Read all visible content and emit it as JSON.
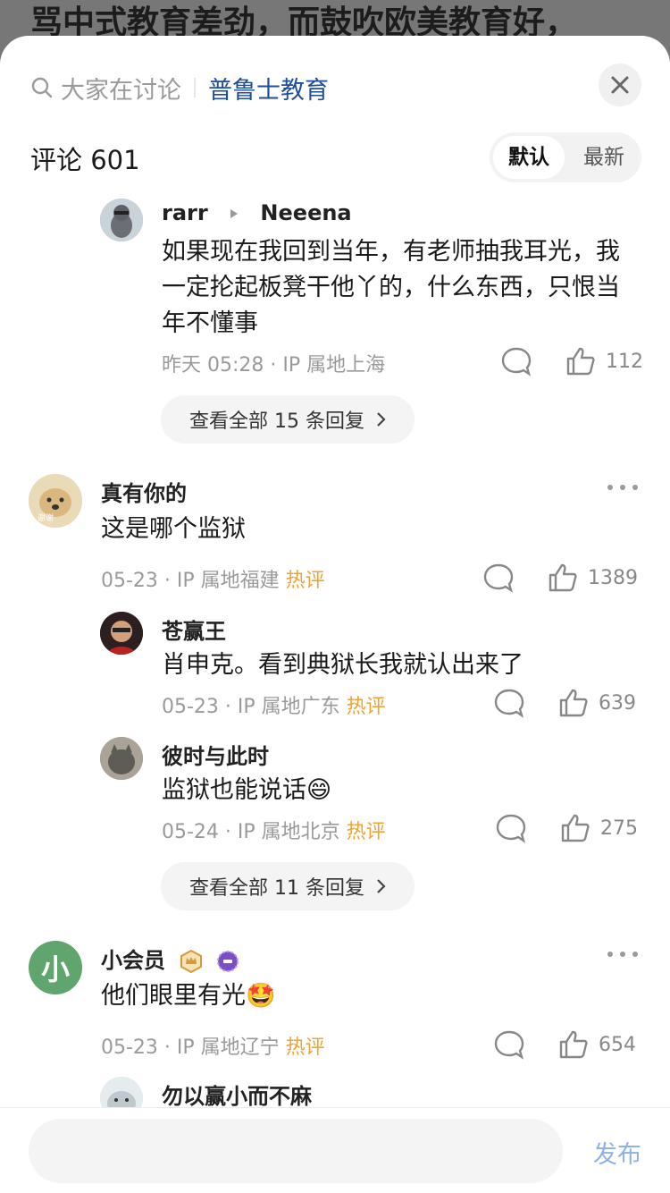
{
  "background_title": "骂中式教育差劲，而鼓吹欧美教育好，",
  "search": {
    "placeholder": "大家在讨论",
    "topic": "普鲁士教育"
  },
  "comments_header": {
    "label": "评论",
    "count": "601"
  },
  "sort": {
    "default": "默认",
    "latest": "最新"
  },
  "reply_rarr": {
    "user": "rarr",
    "reply_to": "Neeena",
    "text": "如果现在我回到当年，有老师抽我耳光，我一定抡起板凳干他丫的，什么东西，只恨当年不懂事",
    "time": "昨天 05:28",
    "location": "IP 属地上海",
    "likes": "112"
  },
  "view_all_1": "查看全部 15 条回复",
  "comment_2": {
    "user": "真有你的",
    "text": "这是哪个监狱",
    "time": "05-23",
    "location": "IP 属地福建",
    "hot": "热评",
    "likes": "1389",
    "avatar_text": "谢谢"
  },
  "reply_cang": {
    "user": "苍赢王",
    "text": "肖申克。看到典狱长我就认出来了",
    "time": "05-23",
    "location": "IP 属地广东",
    "hot": "热评",
    "likes": "639"
  },
  "reply_bishi": {
    "user": "彼时与此时",
    "text": "监狱也能说话😄",
    "time": "05-24",
    "location": "IP 属地北京",
    "hot": "热评",
    "likes": "275"
  },
  "view_all_2": "查看全部 11 条回复",
  "comment_3": {
    "user": "小会员",
    "text": "他们眼里有光🤩",
    "time": "05-23",
    "location": "IP 属地辽宁",
    "hot": "热评",
    "likes": "654",
    "avatar_text": "小"
  },
  "reply_partial": {
    "user": "勿以赢小而不麻"
  },
  "bottom": {
    "publish": "发布"
  },
  "colors": {
    "hot": "#f0a232",
    "topic": "#1d4e9e",
    "publish": "#8fb2e6"
  }
}
